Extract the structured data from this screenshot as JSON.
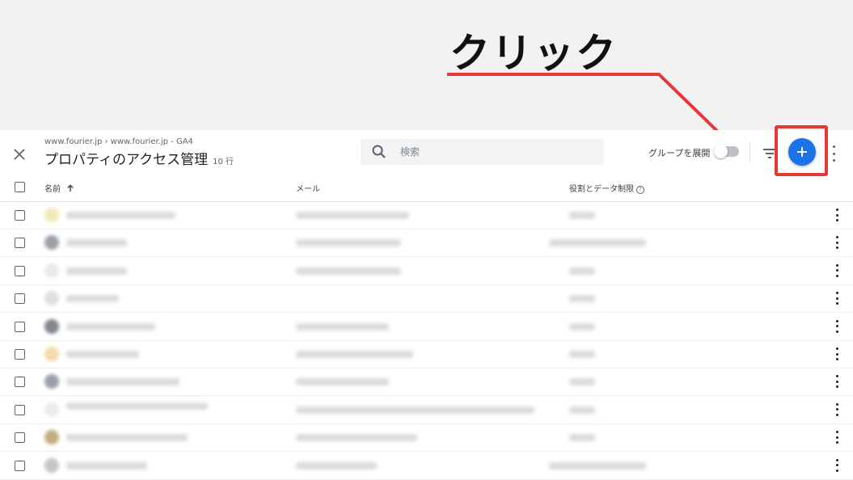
{
  "annotation": {
    "label": "クリック",
    "color": "#e53935"
  },
  "header": {
    "breadcrumb": "www.fourier.jp › www.fourier.jp - GA4",
    "title": "プロパティのアクセス管理",
    "row_count": "10 行"
  },
  "search": {
    "placeholder": "検索"
  },
  "toolbar": {
    "expand_groups_label": "グループを展開",
    "add_button_label": "+"
  },
  "columns": {
    "name": "名前",
    "email": "メール",
    "role": "役割とデータ制限"
  },
  "icons": [
    "close-icon",
    "search-icon",
    "filter-icon",
    "plus-icon",
    "more-vert-icon",
    "arrow-upward-icon",
    "help-icon"
  ],
  "colors": {
    "accent": "#1a73e8",
    "highlight": "#e53935"
  }
}
